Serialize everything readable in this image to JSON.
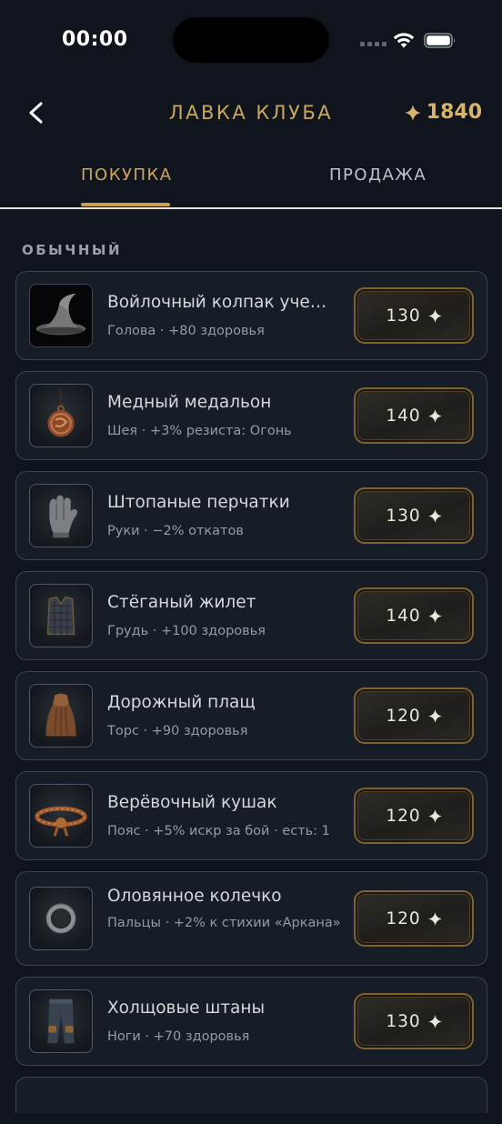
{
  "status_bar": {
    "time": "00:00"
  },
  "header": {
    "title": "ЛАВКА КЛУБА",
    "balance": "1840",
    "currency_icon": "spark-icon"
  },
  "tabs": [
    {
      "label": "ПОКУПКА",
      "active": true
    },
    {
      "label": "ПРОДАЖА",
      "active": false
    }
  ],
  "section": {
    "label": "ОБЫЧНЫЙ"
  },
  "items": [
    {
      "name": "Войлочный колпак уче…",
      "desc": "Голова · +80 здоровья",
      "price": "130",
      "icon": "wizard-hat-icon"
    },
    {
      "name": "Медный медальон",
      "desc": "Шея · +3% резиста: Огонь",
      "price": "140",
      "icon": "medallion-icon"
    },
    {
      "name": "Штопаные перчатки",
      "desc": "Руки · −2% откатов",
      "price": "130",
      "icon": "gloves-icon"
    },
    {
      "name": "Стёганый жилет",
      "desc": "Грудь · +100 здоровья",
      "price": "140",
      "icon": "vest-icon"
    },
    {
      "name": "Дорожный плащ",
      "desc": "Торс · +90 здоровья",
      "price": "120",
      "icon": "cloak-icon"
    },
    {
      "name": "Верёвочный кушак",
      "desc": "Пояс · +5% искр за бой · есть: 1",
      "price": "120",
      "icon": "belt-icon"
    },
    {
      "name": "Оловянное колечко",
      "desc": "Пальцы · +2% к стихии «Аркана»",
      "price": "120",
      "icon": "ring-icon"
    },
    {
      "name": "Холщовые штаны",
      "desc": "Ноги · +70 здоровья",
      "price": "130",
      "icon": "pants-icon"
    }
  ],
  "colors": {
    "accent": "#c9a760",
    "background": "#10151d",
    "card": "#171d27",
    "card_border": "#3a4352"
  }
}
